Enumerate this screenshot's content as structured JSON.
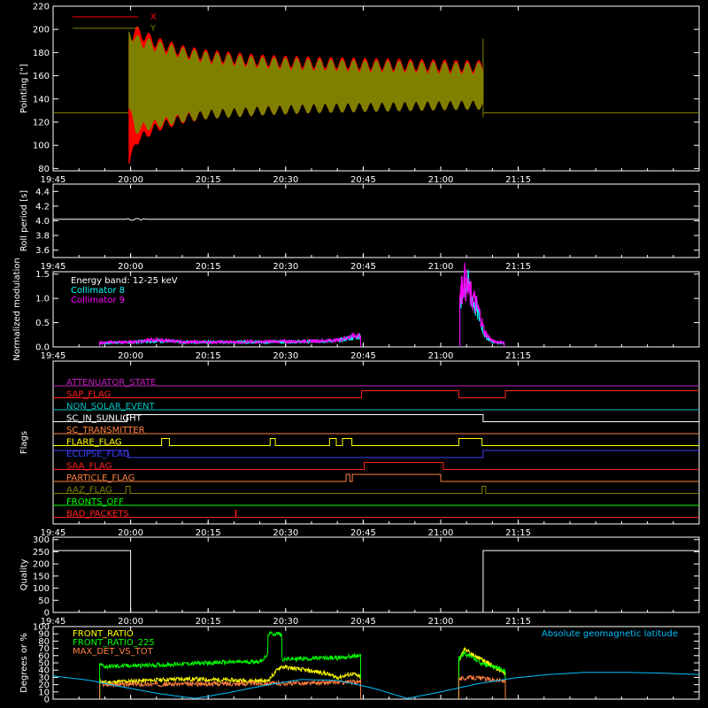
{
  "chart_data": [
    {
      "type": "line",
      "ylabel": "Pointing [\"]",
      "ylim": [
        78,
        220
      ],
      "yticks": [
        80,
        100,
        120,
        140,
        160,
        180,
        200,
        220
      ],
      "xlim_min": [
        1185,
        1310
      ],
      "xticks": [
        "19:45",
        "20:00",
        "20:15",
        "20:30",
        "20:45",
        "21:00",
        "21:15"
      ],
      "legend": [
        {
          "name": "X",
          "color": "#ff0000"
        },
        {
          "name": "Y",
          "color": "#808000"
        }
      ],
      "series": [
        {
          "name": "X",
          "color": "#ff0000",
          "x": [
            1199.7,
            1201,
            1205,
            1210,
            1215,
            1225,
            1235,
            1245,
            1255,
            1265,
            1268.2
          ],
          "upper": [
            196,
            203,
            193,
            186,
            182,
            178,
            176,
            175,
            174,
            173,
            173
          ],
          "lower": [
            80,
            100,
            112,
            119,
            123,
            126,
            128,
            129,
            130,
            131,
            131
          ]
        },
        {
          "name": "Y",
          "color": "#808000",
          "x": [
            1199.7,
            1201,
            1205,
            1210,
            1215,
            1225,
            1235,
            1245,
            1255,
            1265,
            1268.2
          ],
          "upper": [
            205,
            197,
            192,
            186,
            182,
            178,
            176,
            175,
            174,
            173,
            173
          ],
          "lower": [
            128,
            110,
            115,
            120,
            123,
            126,
            128,
            129,
            130,
            131,
            131
          ],
          "baseline": 128
        }
      ]
    },
    {
      "type": "line",
      "ylabel": "Roll period [s]",
      "ylim": [
        3.5,
        4.5
      ],
      "yticks": [
        3.6,
        3.8,
        4.0,
        4.2,
        4.4
      ],
      "xticks": [
        "19:45",
        "20:00",
        "20:15",
        "20:30",
        "20:45",
        "21:00",
        "21:15"
      ],
      "series": [
        {
          "name": "roll",
          "color": "#ffffff",
          "value": 4.02
        }
      ]
    },
    {
      "type": "line",
      "ylabel": "Normalized modulation",
      "ylim": [
        0,
        1.55
      ],
      "yticks": [
        0.0,
        0.5,
        1.0,
        1.5
      ],
      "xticks": [
        "19:45",
        "20:00",
        "20:15",
        "20:30",
        "20:45",
        "21:00",
        "21:15"
      ],
      "annotations": [
        "Energy band: 12-25 keV",
        "Collimator 8",
        "Collimator 9"
      ],
      "series": [
        {
          "name": "Collimator 8",
          "color": "#00ffff",
          "x": [
            1194,
            1200,
            1205,
            1210,
            1220,
            1235,
            1240,
            1243,
            1244.5
          ],
          "y": [
            0.08,
            0.1,
            0.13,
            0.1,
            0.1,
            0.11,
            0.13,
            0.2,
            0.22
          ]
        },
        {
          "name": "Collimator 9",
          "color": "#ff00ff",
          "x": [
            1194,
            1200,
            1205,
            1210,
            1220,
            1235,
            1240,
            1243,
            1244.5
          ],
          "y": [
            0.09,
            0.1,
            0.15,
            0.1,
            0.1,
            0.12,
            0.14,
            0.22,
            0.25
          ]
        },
        {
          "name": "Collimator 8 late",
          "color": "#00ffff",
          "x": [
            1263.7,
            1264.5,
            1265.5,
            1266.5,
            1267.5,
            1268.5,
            1270,
            1272.3
          ],
          "y": [
            0.8,
            1.35,
            1.2,
            0.9,
            0.6,
            0.25,
            0.1,
            0.08
          ]
        },
        {
          "name": "Collimator 9 late",
          "color": "#ff00ff",
          "x": [
            1263.7,
            1264.5,
            1265.5,
            1266.5,
            1267.5,
            1268.5,
            1270,
            1272.3
          ],
          "y": [
            1.0,
            1.4,
            1.1,
            0.95,
            0.7,
            0.3,
            0.12,
            0.09
          ]
        }
      ]
    },
    {
      "type": "line",
      "ylabel": "Flags",
      "xticks": [
        "19:45",
        "20:00",
        "20:15",
        "20:30",
        "20:45",
        "21:00",
        "21:15"
      ],
      "flags": [
        {
          "name": "ATTENUATOR_STATE",
          "color": "#c020c0",
          "on": []
        },
        {
          "name": "SAP_FLAG",
          "color": "#ff2020",
          "on": [
            [
              1185,
              1244.7
            ],
            [
              1263.5,
              1272.5
            ]
          ],
          "invert": true
        },
        {
          "name": "NON_SOLAR_EVENT",
          "color": "#00c0c0",
          "on": []
        },
        {
          "name": "SC_IN_SUNLIGHT",
          "color": "#ffffff",
          "on": [
            [
              1199.3,
              1268.2
            ]
          ]
        },
        {
          "name": "SC_TRANSMITTER",
          "color": "#ff8040",
          "on": []
        },
        {
          "name": "FLARE_FLAG",
          "color": "#ffff00",
          "on": [
            [
              1206,
              1207.5
            ],
            [
              1227,
              1228
            ],
            [
              1238.5,
              1239.8
            ],
            [
              1241,
              1242.8
            ],
            [
              1263.5,
              1268
            ]
          ]
        },
        {
          "name": "ECLIPSE_FLAG",
          "color": "#4040ff",
          "on": [
            [
              1185,
              1199.5
            ],
            [
              1268.2,
              1310
            ]
          ]
        },
        {
          "name": "SAA_FLAG",
          "color": "#ff2020",
          "on": [
            [
              1245.2,
              1260.5
            ]
          ]
        },
        {
          "name": "PARTICLE_FLAG",
          "color": "#ff8040",
          "on": [
            [
              1241.7,
              1242.4
            ],
            [
              1242.9,
              1260
            ]
          ]
        },
        {
          "name": "AAZ_FLAG",
          "color": "#808000",
          "on": [
            [
              1199.1,
              1199.9
            ],
            [
              1268,
              1268.7
            ]
          ]
        },
        {
          "name": "FRONTS_OFF",
          "color": "#00ff00",
          "on": []
        },
        {
          "name": "BAD_PACKETS",
          "color": "#ff2020",
          "on": [
            [
              1220.3,
              1220.4
            ]
          ]
        }
      ]
    },
    {
      "type": "line",
      "ylabel": "Quality",
      "ylim": [
        0,
        310
      ],
      "yticks": [
        0,
        50,
        100,
        150,
        200,
        250,
        300
      ],
      "xticks": [
        "19:45",
        "20:00",
        "20:15",
        "20:30",
        "20:45",
        "21:00",
        "21:15"
      ],
      "series": [
        {
          "name": "quality",
          "color": "#ffffff",
          "x": [
            1185,
            1200,
            1200,
            1268.2,
            1268.2,
            1310
          ],
          "y": [
            255,
            255,
            0,
            0,
            255,
            255
          ]
        }
      ]
    },
    {
      "type": "line",
      "ylabel": "Degrees or %",
      "ylim": [
        0,
        100
      ],
      "yticks": [
        0,
        10,
        20,
        30,
        40,
        50,
        60,
        70,
        80,
        90,
        100
      ],
      "xticks": [
        "19:45",
        "20:00",
        "20:15",
        "20:30",
        "20:45",
        "21:00",
        "21:15"
      ],
      "legend": [
        {
          "name": "FRONT_RATIO",
          "color": "#ffff00"
        },
        {
          "name": "FRONT_RATIO_225",
          "color": "#00ff00"
        },
        {
          "name": "MAX_DET_VS_TOT",
          "color": "#ff8040"
        },
        {
          "name": "Absolute geomagnetic latitude",
          "color": "#00c0ff"
        }
      ],
      "series": [
        {
          "name": "FRONT_RATIO",
          "color": "#ffff00",
          "x": [
            1194,
            1195,
            1210,
            1220,
            1226.5,
            1229,
            1237.5,
            1240,
            1243,
            1244.5
          ],
          "y": [
            25,
            23,
            28,
            26,
            25,
            45,
            36,
            30,
            35,
            30
          ]
        },
        {
          "name": "FRONT_RATIO_225",
          "color": "#00ff00",
          "x": [
            1194,
            1195,
            1205,
            1215,
            1225,
            1226.5,
            1226.5,
            1229.2,
            1229.2,
            1240,
            1244.5
          ],
          "y": [
            48,
            45,
            47,
            50,
            52,
            60,
            90,
            90,
            55,
            57,
            60
          ]
        },
        {
          "name": "MAX_DET_VS_TOT",
          "color": "#ff8040",
          "x": [
            1194,
            1195,
            1215,
            1235,
            1244.5
          ],
          "y": [
            22,
            20,
            21,
            22,
            24
          ]
        },
        {
          "name": "FRONT_RATIO late",
          "color": "#ffff00",
          "x": [
            1263.5,
            1264.5,
            1266,
            1268,
            1272.5
          ],
          "y": [
            50,
            70,
            62,
            55,
            35
          ]
        },
        {
          "name": "FRONT_RATIO_225 late",
          "color": "#00ff00",
          "x": [
            1263.5,
            1264.5,
            1266,
            1268,
            1272.5
          ],
          "y": [
            55,
            63,
            58,
            48,
            40
          ]
        },
        {
          "name": "MAX_DET_VS_TOT late",
          "color": "#ff8040",
          "x": [
            1263.5,
            1266,
            1272.5
          ],
          "y": [
            28,
            30,
            25
          ]
        },
        {
          "name": "Absolute geomagnetic latitude",
          "color": "#00c0ff",
          "x": [
            1185,
            1192,
            1199,
            1206,
            1212.5,
            1219,
            1226,
            1233,
            1240,
            1247,
            1253.5,
            1260,
            1267,
            1274,
            1281,
            1288,
            1295,
            1302,
            1310
          ],
          "y": [
            32,
            26,
            16,
            7,
            1,
            9,
            19,
            27,
            26,
            15,
            1,
            10,
            21,
            29,
            34,
            37,
            37,
            36,
            34
          ]
        }
      ]
    }
  ]
}
